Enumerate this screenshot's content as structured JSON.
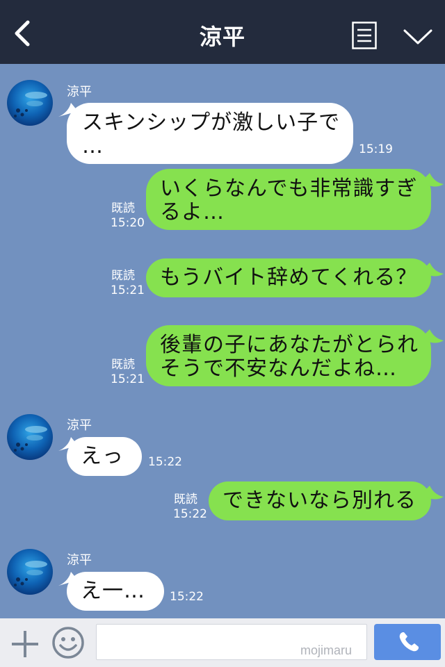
{
  "header": {
    "title": "涼平"
  },
  "contact": {
    "name": "涼平"
  },
  "messages": [
    {
      "direction": "in",
      "lines": [
        "スキンシップが激しい子で",
        "…"
      ],
      "time": "15:19"
    },
    {
      "direction": "out",
      "lines": [
        "いくらなんでも非常識すぎ",
        "るよ…"
      ],
      "read": "既読",
      "time": "15:20"
    },
    {
      "direction": "out",
      "lines": [
        "もうバイト辞めてくれる？"
      ],
      "read": "既読",
      "time": "15:21"
    },
    {
      "direction": "out",
      "lines": [
        "後輩の子にあなたがとられ",
        "そうで不安なんだよね…"
      ],
      "read": "既読",
      "time": "15:21"
    },
    {
      "direction": "in",
      "lines": [
        "えっ"
      ],
      "time": "15:22"
    },
    {
      "direction": "out",
      "lines": [
        "できないなら別れる"
      ],
      "read": "既読",
      "time": "15:22"
    },
    {
      "direction": "in",
      "lines": [
        "え一…"
      ],
      "time": "15:22"
    }
  ],
  "footer": {
    "input_placeholder": "",
    "watermark": "mojimaru"
  },
  "colors": {
    "chat_background": "#7291bf",
    "header_background": "#232b3d",
    "incoming_bubble": "#ffffff",
    "outgoing_bubble": "#86e14f",
    "call_button": "#5a8ee3"
  },
  "icons": [
    "back-icon",
    "menu-icon",
    "chevron-down-icon",
    "plus-icon",
    "smile-icon",
    "phone-icon",
    "avatar"
  ]
}
